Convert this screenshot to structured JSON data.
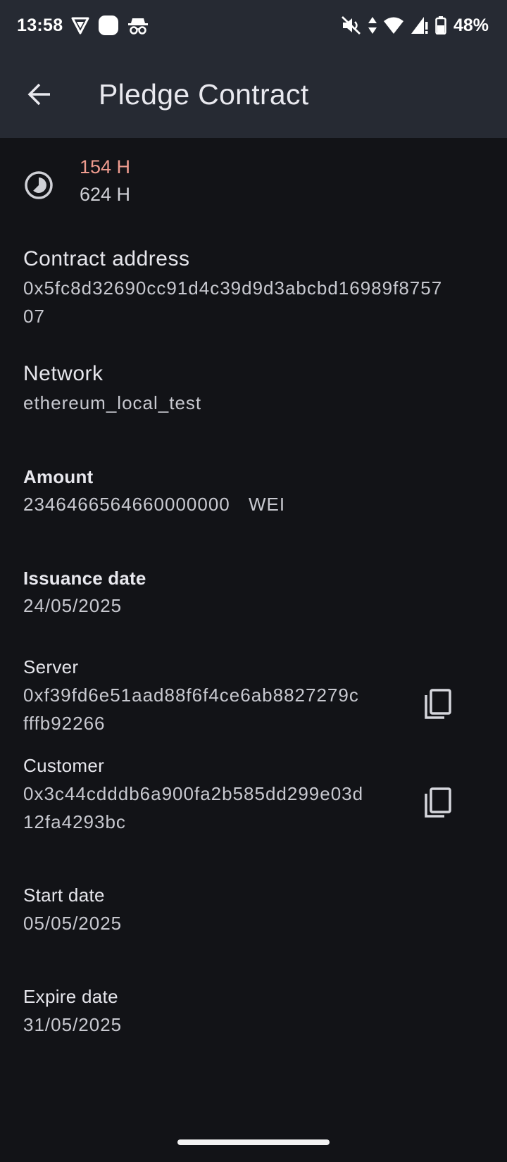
{
  "status_bar": {
    "time": "13:58",
    "battery": "48%",
    "left_icons": [
      "vpn-shield-icon",
      "notification-app-icon",
      "incognito-icon"
    ],
    "right_icons": [
      "mute-icon",
      "data-arrows-icon",
      "wifi-icon",
      "cell-signal-icon",
      "battery-icon"
    ]
  },
  "app_bar": {
    "back_icon": "arrow-back-icon",
    "title": "Pledge Contract"
  },
  "timer": {
    "icon": "timelapse-icon",
    "remaining": "154 H",
    "total": "624 H"
  },
  "contract_address": {
    "label": "Contract address",
    "value_line1": "0x5fc8d32690cc91d4c39d9d3abcbd16989f8757",
    "value_line2": "07"
  },
  "network": {
    "label": "Network",
    "value": "ethereum_local_test"
  },
  "amount": {
    "label": "Amount",
    "value": "2346466564660000000",
    "unit": "WEI"
  },
  "issuance_date": {
    "label": "Issuance date",
    "value": "24/05/2025"
  },
  "server": {
    "label": "Server",
    "value_line1": "0xf39fd6e51aad88f6f4ce6ab8827279c",
    "value_line2": "fffb92266",
    "copy_icon": "copy-icon"
  },
  "customer": {
    "label": "Customer",
    "value_line1": "0x3c44cdddb6a900fa2b585dd299e03d",
    "value_line2": "12fa4293bc",
    "copy_icon": "copy-icon"
  },
  "start_date": {
    "label": "Start date",
    "value": "05/05/2025"
  },
  "expire_date": {
    "label": "Expire date",
    "value": "31/05/2025"
  },
  "colors": {
    "background": "#121317",
    "app_bar": "#262a33",
    "timer_remaining": "#ef9c8f",
    "text_primary": "#e6e6ec",
    "text_secondary": "#c8c9d0"
  }
}
